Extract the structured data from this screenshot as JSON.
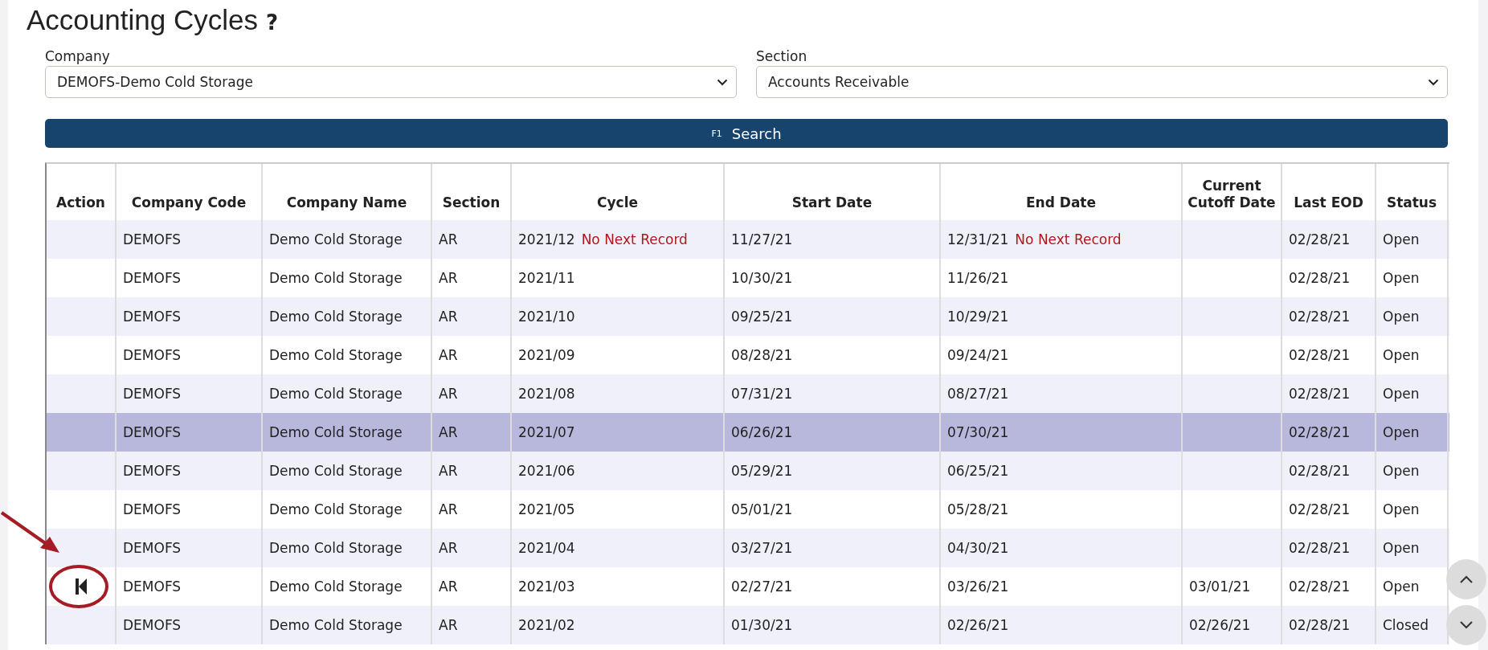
{
  "page": {
    "title": "Accounting Cycles",
    "help": "?"
  },
  "filters": [
    {
      "label": "Company",
      "value": "DEMOFS-Demo Cold Storage"
    },
    {
      "label": "Section",
      "value": "Accounts Receivable"
    }
  ],
  "search_button": {
    "key": "F1",
    "label": "Search"
  },
  "table": {
    "columns": [
      "Action",
      "Company Code",
      "Company Name",
      "Section",
      "Cycle",
      "Start Date",
      "End Date",
      "Current Cutoff Date",
      "Last EOD",
      "Status"
    ],
    "rows": [
      {
        "action": false,
        "code": "DEMOFS",
        "name": "Demo Cold Storage",
        "section": "AR",
        "cycle": "2021/12",
        "cycle_note": "No Next Record",
        "start": "11/27/21",
        "end": "12/31/21",
        "end_note": "No Next Record",
        "last_eod": "02/28/21",
        "status": "Open",
        "selected": false
      },
      {
        "action": false,
        "code": "DEMOFS",
        "name": "Demo Cold Storage",
        "section": "AR",
        "cycle": "2021/11",
        "start": "10/30/21",
        "end": "11/26/21",
        "last_eod": "02/28/21",
        "status": "Open",
        "selected": false
      },
      {
        "action": false,
        "code": "DEMOFS",
        "name": "Demo Cold Storage",
        "section": "AR",
        "cycle": "2021/10",
        "start": "09/25/21",
        "end": "10/29/21",
        "last_eod": "02/28/21",
        "status": "Open",
        "selected": false
      },
      {
        "action": false,
        "code": "DEMOFS",
        "name": "Demo Cold Storage",
        "section": "AR",
        "cycle": "2021/09",
        "start": "08/28/21",
        "end": "09/24/21",
        "last_eod": "02/28/21",
        "status": "Open",
        "selected": false
      },
      {
        "action": false,
        "code": "DEMOFS",
        "name": "Demo Cold Storage",
        "section": "AR",
        "cycle": "2021/08",
        "start": "07/31/21",
        "end": "08/27/21",
        "last_eod": "02/28/21",
        "status": "Open",
        "selected": false
      },
      {
        "action": false,
        "code": "DEMOFS",
        "name": "Demo Cold Storage",
        "section": "AR",
        "cycle": "2021/07",
        "start": "06/26/21",
        "end": "07/30/21",
        "last_eod": "02/28/21",
        "status": "Open",
        "selected": true
      },
      {
        "action": false,
        "code": "DEMOFS",
        "name": "Demo Cold Storage",
        "section": "AR",
        "cycle": "2021/06",
        "start": "05/29/21",
        "end": "06/25/21",
        "last_eod": "02/28/21",
        "status": "Open",
        "selected": false
      },
      {
        "action": false,
        "code": "DEMOFS",
        "name": "Demo Cold Storage",
        "section": "AR",
        "cycle": "2021/05",
        "start": "05/01/21",
        "end": "05/28/21",
        "last_eod": "02/28/21",
        "status": "Open",
        "selected": false
      },
      {
        "action": false,
        "code": "DEMOFS",
        "name": "Demo Cold Storage",
        "section": "AR",
        "cycle": "2021/04",
        "start": "03/27/21",
        "end": "04/30/21",
        "last_eod": "02/28/21",
        "status": "Open",
        "selected": false
      },
      {
        "action": true,
        "annotated": true,
        "code": "DEMOFS",
        "name": "Demo Cold Storage",
        "section": "AR",
        "cycle": "2021/03",
        "start": "02/27/21",
        "end": "03/26/21",
        "cutoff": "03/01/21",
        "last_eod": "02/28/21",
        "status": "Open",
        "selected": false
      },
      {
        "action": false,
        "code": "DEMOFS",
        "name": "Demo Cold Storage",
        "section": "AR",
        "cycle": "2021/02",
        "start": "01/30/21",
        "end": "02/26/21",
        "cutoff": "02/26/21",
        "last_eod": "02/28/21",
        "status": "Closed",
        "selected": false
      }
    ]
  }
}
